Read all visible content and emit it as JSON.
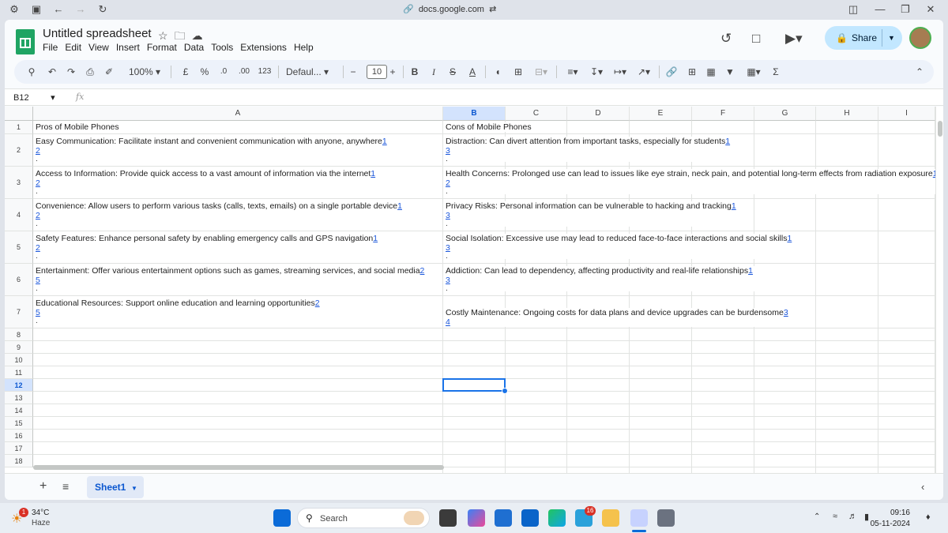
{
  "browser": {
    "url": "docs.google.com"
  },
  "doc": {
    "title": "Untitled spreadsheet"
  },
  "menu": [
    "File",
    "Edit",
    "View",
    "Insert",
    "Format",
    "Data",
    "Tools",
    "Extensions",
    "Help"
  ],
  "share": {
    "label": "Share"
  },
  "toolbar": {
    "zoom": "100%",
    "currency": "£",
    "percent": "%",
    "dec_less": ".0",
    "dec_more": ".00",
    "num_format": "123",
    "font": "Defaul...",
    "font_size": "10",
    "minus": "−",
    "plus": "+",
    "bold": "B",
    "italic": "I",
    "strike": "S",
    "textcolor": "A"
  },
  "formula_bar": {
    "namebox": "B12",
    "fx": "fx"
  },
  "columns": [
    "A",
    "B",
    "C",
    "D",
    "E",
    "F",
    "G",
    "H",
    "I"
  ],
  "rows": [
    "1",
    "2",
    "3",
    "4",
    "5",
    "6",
    "7",
    "8",
    "9",
    "10",
    "11",
    "12",
    "13",
    "14",
    "15",
    "16",
    "17",
    "18"
  ],
  "selected": {
    "col": "B",
    "row": "12"
  },
  "cells": {
    "a1": "Pros of Mobile Phones",
    "b1": "Cons of Mobile Phones",
    "a2": {
      "text": "Easy Communication: Facilitate instant and convenient communication with anyone, anywhere",
      "r1": "1",
      "r2": "2",
      "dot": "."
    },
    "b2": {
      "text": "Distraction: Can divert attention from important tasks, especially for students",
      "r1": "1",
      "r2": "3",
      "dot": "."
    },
    "a3": {
      "text": "Access to Information: Provide quick access to a vast amount of information via the internet",
      "r1": "1",
      "r2": "2",
      "dot": "."
    },
    "b3": {
      "text": "Health Concerns: Prolonged use can lead to issues like eye strain, neck pain, and potential long-term effects from radiation exposure",
      "r1": "1",
      "r2": "2",
      "dot": "."
    },
    "a4": {
      "text": "Convenience: Allow users to perform various tasks (calls, texts, emails) on a single portable device",
      "r1": "1",
      "r2": "2",
      "dot": "."
    },
    "b4": {
      "text": "Privacy Risks: Personal information can be vulnerable to hacking and tracking",
      "r1": "1",
      "r2": "3",
      "dot": "."
    },
    "a5": {
      "text": "Safety Features: Enhance personal safety by enabling emergency calls and GPS navigation",
      "r1": "1",
      "r2": "2",
      "dot": "."
    },
    "b5": {
      "text": "Social Isolation: Excessive use may lead to reduced face-to-face interactions and social skills",
      "r1": "1",
      "r2": "3",
      "dot": "."
    },
    "a6": {
      "text": "Entertainment: Offer various entertainment options such as games, streaming services, and social media",
      "r1": "2",
      "r2": "5",
      "dot": "."
    },
    "b6": {
      "text": "Addiction: Can lead to dependency, affecting productivity and real-life relationships",
      "r1": "1",
      "r2": "3",
      "dot": "."
    },
    "a7": {
      "text": "Educational Resources: Support online education and learning opportunities",
      "r1": "2",
      "r2": "5",
      "dot": "."
    },
    "b7": {
      "text": "Costly Maintenance: Ongoing costs for data plans and device upgrades can be burdensome",
      "r1": "3",
      "r2": "4"
    }
  },
  "sheets": [
    {
      "name": "Sheet1"
    }
  ],
  "taskbar": {
    "weather_temp": "34°C",
    "weather_desc": "Haze",
    "weather_badge": "1",
    "search": "Search",
    "telegram_badge": "16",
    "time": "09:16",
    "date": "05-11-2024"
  },
  "colors": {
    "accent": "#1a73e8",
    "sheets_green": "#1fa463",
    "share_bg": "#c2e7ff"
  }
}
